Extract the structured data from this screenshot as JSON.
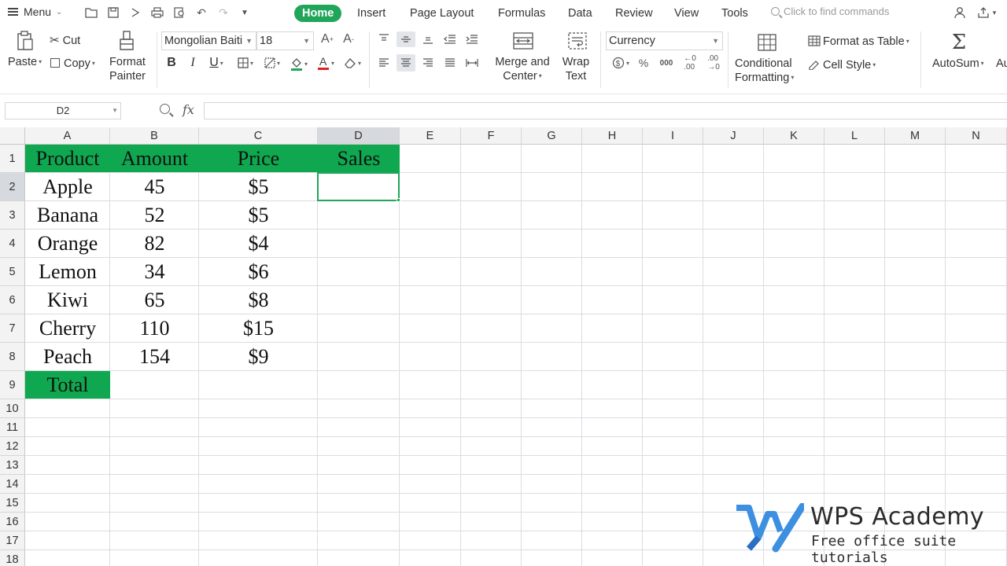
{
  "menubar": {
    "menu_label": "Menu",
    "tabs": [
      "Home",
      "Insert",
      "Page Layout",
      "Formulas",
      "Data",
      "Review",
      "View",
      "Tools"
    ],
    "search_placeholder": "Click to find commands"
  },
  "ribbon": {
    "paste": "Paste",
    "cut": "Cut",
    "copy": "Copy",
    "format_painter_1": "Format",
    "format_painter_2": "Painter",
    "font_name": "Mongolian Baiti",
    "font_size": "18",
    "merge_1": "Merge and",
    "merge_2": "Center",
    "wrap_1": "Wrap",
    "wrap_2": "Text",
    "number_format": "Currency",
    "cond_1": "Conditional",
    "cond_2": "Formatting",
    "format_table": "Format as Table",
    "cell_style": "Cell Style",
    "autosum": "AutoSum",
    "autosum_cut": "Au"
  },
  "formula_bar": {
    "name_box": "D2",
    "fx": "fx",
    "formula": ""
  },
  "sheet": {
    "columns": [
      "A",
      "B",
      "C",
      "D",
      "E",
      "F",
      "G",
      "H",
      "I",
      "J",
      "K",
      "L",
      "M",
      "N"
    ],
    "rows": [
      "1",
      "2",
      "3",
      "4",
      "5",
      "6",
      "7",
      "8",
      "9",
      "10",
      "11",
      "12",
      "13",
      "14",
      "15",
      "16",
      "17",
      "18"
    ],
    "header": [
      "Product",
      "Amount",
      "Price",
      "Sales"
    ],
    "data": [
      [
        "Apple",
        "45",
        "$5"
      ],
      [
        "Banana",
        "52",
        "$5"
      ],
      [
        "Orange",
        "82",
        "$4"
      ],
      [
        "Lemon",
        "34",
        "$6"
      ],
      [
        "Kiwi",
        "65",
        "$8"
      ],
      [
        "Cherry",
        "110",
        "$15"
      ],
      [
        "Peach",
        "154",
        "$9"
      ]
    ],
    "total_label": "Total",
    "selected_cell": "D2",
    "header_fill": "#0fa850",
    "selection_color": "#20a55a"
  },
  "watermark": {
    "title": "WPS Academy",
    "subtitle": "Free office suite tutorials"
  }
}
